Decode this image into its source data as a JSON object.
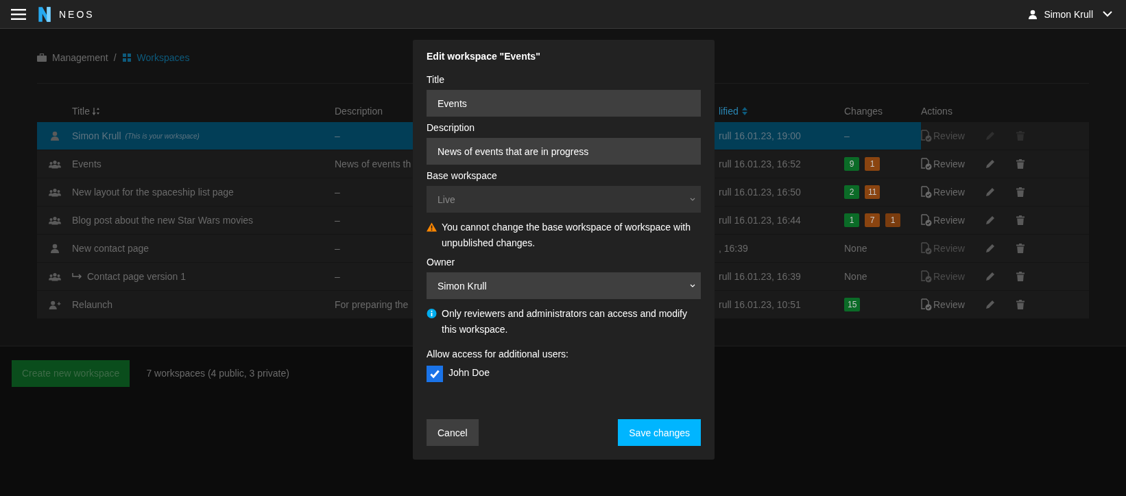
{
  "topbar": {
    "brand": "NEOS",
    "user": "Simon Krull"
  },
  "breadcrumb": [
    {
      "label": "Management",
      "kind": "management",
      "selected": false
    },
    {
      "separator": "/",
      "label": "Workspaces",
      "kind": "workspaces",
      "selected": true
    }
  ],
  "table": {
    "columns": [
      {
        "label": "Title",
        "sorted": false
      },
      {
        "label": "Description",
        "sorted": false
      },
      {
        "label": "lified",
        "sorted": true
      },
      {
        "label": "Changes",
        "sorted": false
      },
      {
        "label": "Actions",
        "sorted": false
      }
    ],
    "rows": [
      {
        "kind": "personal",
        "title": "Simon Krull",
        "note": "(This is your workspace)",
        "description": "–",
        "modified": "rull 16.01.23, 19:00",
        "changes": "–",
        "review": "Review",
        "review_disabled": true,
        "selected": true
      },
      {
        "kind": "shared",
        "title": "Events",
        "description": "News of events th",
        "modified": "rull 16.01.23, 16:52",
        "badges": [
          {
            "count": "9",
            "color": "#0b6b27"
          },
          {
            "count": "1",
            "color": "#8a4410"
          }
        ],
        "review": "Review",
        "review_disabled": false,
        "selected": false
      },
      {
        "kind": "shared",
        "title": "New layout for the spaceship list page",
        "description": "–",
        "modified": "rull 16.01.23, 16:50",
        "badges": [
          {
            "count": "2",
            "color": "#0b6b27"
          },
          {
            "count": "11",
            "color": "#8a4410"
          }
        ],
        "review": "Review",
        "review_disabled": false,
        "selected": false
      },
      {
        "kind": "shared",
        "title": "Blog post about the new Star Wars movies",
        "description": "–",
        "modified": "rull 16.01.23, 16:44",
        "badges": [
          {
            "count": "1",
            "color": "#0b6b27"
          },
          {
            "count": "7",
            "color": "#8a4410"
          },
          {
            "count": "1",
            "color": "#7a3c0e"
          }
        ],
        "review": "Review",
        "review_disabled": false,
        "selected": false
      },
      {
        "kind": "personal",
        "title": "New contact page",
        "description": "–",
        "modified": ", 16:39",
        "changes": "None",
        "review": "Review",
        "review_disabled": true,
        "selected": false,
        "children": [
          {
            "kind": "shared",
            "title": "Contact page version 1",
            "description": "–",
            "modified": "rull 16.01.23, 16:39",
            "changes": "None",
            "review": "Review",
            "review_disabled": true,
            "selected": false
          }
        ]
      },
      {
        "kind": "private",
        "title": "Relaunch",
        "description": "For preparing the",
        "modified": "rull 16.01.23, 10:51",
        "badges": [
          {
            "count": "15",
            "color": "#0b6b27"
          }
        ],
        "review": "Review",
        "review_disabled": false,
        "selected": false
      }
    ]
  },
  "footer": {
    "create_button": "Create new workspace",
    "summary": "7 workspaces (4 public, 3 private)"
  },
  "dialog": {
    "title": "Edit workspace \"Events\"",
    "fields": [
      {
        "kind": "text",
        "label": "Title",
        "value": "Events",
        "disabled": false
      },
      {
        "kind": "text",
        "label": "Description",
        "value": "News of events that are in progress",
        "disabled": false
      },
      {
        "kind": "select",
        "label": "Base workspace",
        "value": "Live",
        "disabled": true,
        "note": {
          "kind": "warning",
          "text": "You cannot change the base workspace of workspace with unpublished changes."
        }
      },
      {
        "kind": "select",
        "label": "Owner",
        "value": "Simon Krull",
        "disabled": false,
        "note": {
          "kind": "info",
          "text": "Only reviewers and administrators can access and modify this workspace."
        }
      }
    ],
    "users_label": "Allow access for additional users:",
    "users": [
      {
        "name": "John Doe",
        "checked": true
      }
    ],
    "cancel": "Cancel",
    "save": "Save changes"
  }
}
